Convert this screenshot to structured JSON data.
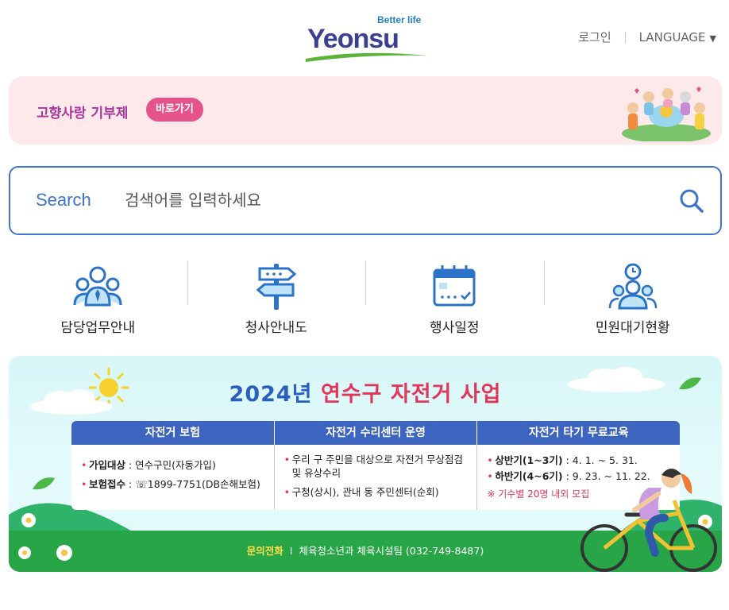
{
  "header": {
    "logo_tagline": "Better life",
    "logo_word": "Yeonsu",
    "login": "로그인",
    "language": "LANGUAGE",
    "language_caret": "▼"
  },
  "donation_banner": {
    "title": "고향사랑 기부제",
    "button": "바로가기"
  },
  "search": {
    "label": "Search",
    "placeholder": "검색어를 입력하세요",
    "icon": "search-icon"
  },
  "quick_menu": [
    {
      "label": "담당업무안내",
      "icon": "staff-icon"
    },
    {
      "label": "청사안내도",
      "icon": "signpost-icon"
    },
    {
      "label": "행사일정",
      "icon": "calendar-icon"
    },
    {
      "label": "민원대기현황",
      "icon": "queue-status-icon"
    }
  ],
  "bike_banner": {
    "headline_year": "2024년",
    "headline_title": "연수구 자전거 사업",
    "columns": [
      {
        "header": "자전거 보험",
        "rows": [
          {
            "key": "가입대상",
            "value": " : 연수구민(자동가입)"
          },
          {
            "key": "보험접수",
            "value": " : ☏1899-7751(DB손해보험)"
          }
        ]
      },
      {
        "header": "자전거 수리센터 운영",
        "rows": [
          {
            "key": "",
            "value": "우리 구 주민을 대상으로 자전거 무상점검 및 유상수리"
          },
          {
            "key": "",
            "value": "구청(상시), 관내 동 주민센터(순회)"
          }
        ]
      },
      {
        "header": "자전거 타기 무료교육",
        "rows": [
          {
            "key": "상반기(1~3기)",
            "value": " : 4. 1. ~ 5. 31."
          },
          {
            "key": "하반기(4~6기)",
            "value": " : 9. 23. ~ 11. 22."
          }
        ],
        "note": "※ 기수별 20명 내외 모집"
      }
    ],
    "contact_key": "문의전화",
    "contact_sep": "I",
    "contact_value": "체육청소년과 체육시설팀 (032-749-8487)"
  },
  "colors": {
    "accent_blue": "#3f76cc",
    "pink": "#e5538a",
    "purple": "#a6379b",
    "banner_red": "#e0365a",
    "green": "#27a547"
  }
}
